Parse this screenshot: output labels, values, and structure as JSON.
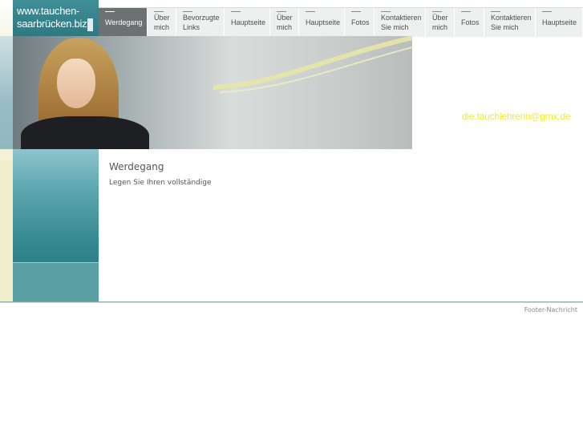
{
  "logo": {
    "line1": "www.tauchen-",
    "line2": "saarbrücken.biz"
  },
  "nav": {
    "items": [
      {
        "label": "Werdegang",
        "active": true
      },
      {
        "label": "Über\nmich"
      },
      {
        "label": "Bevorzugte\nLinks"
      },
      {
        "label": "Hauptseite"
      },
      {
        "label": "Über\nmich"
      },
      {
        "label": "Hauptseite"
      },
      {
        "label": "Fotos"
      },
      {
        "label": "Kontaktieren\nSie mich"
      },
      {
        "label": "Über\nmich"
      },
      {
        "label": "Fotos"
      },
      {
        "label": "Kontaktieren\nSie mich"
      },
      {
        "label": "Hauptseite"
      }
    ]
  },
  "header": {
    "email": "die.tauchlehrerin@gmx.de"
  },
  "content": {
    "title": "Werdegang",
    "text": "Legen Sie Ihren vollständige"
  },
  "footer": {
    "message": "Footer-Nachricht"
  }
}
